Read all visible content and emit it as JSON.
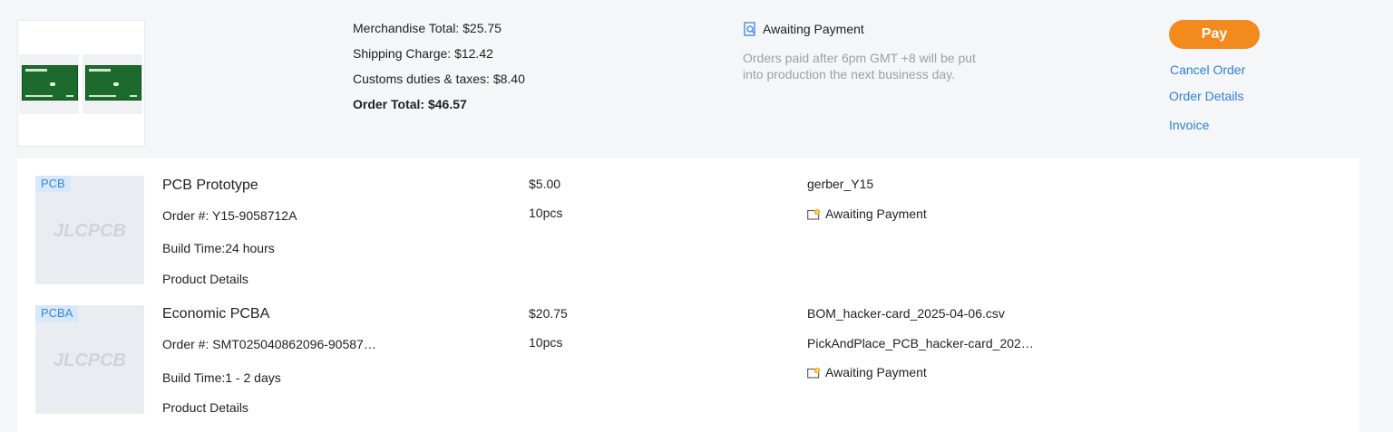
{
  "summary": {
    "merchandise_total": "Merchandise Total: $25.75",
    "shipping_charge": "Shipping Charge: $12.42",
    "customs": "Customs duties & taxes: $8.40",
    "order_total": "Order Total: $46.57",
    "status": "Awaiting Payment",
    "note": "Orders paid after 6pm GMT +8 will be put into production the next business day.",
    "pay_label": "Pay",
    "cancel_label": "Cancel Order",
    "details_label": "Order Details",
    "invoice_label": "Invoice",
    "colors": {
      "accent": "#f28a1e",
      "link": "#2f7fd9"
    }
  },
  "items": [
    {
      "tag": "PCB",
      "logo": "JLCPCB",
      "title": "PCB Prototype",
      "order": "Order #: Y15-9058712A",
      "build": "Build Time:24 hours",
      "details": "Product Details",
      "price": "$5.00",
      "qty": "10pcs",
      "files": [
        "gerber_Y15"
      ],
      "status": "Awaiting Payment"
    },
    {
      "tag": "PCBA",
      "logo": "JLCPCB",
      "title": "Economic PCBA",
      "order": "Order #: SMT025040862096-90587…",
      "build": "Build Time:1 - 2 days",
      "details": "Product Details",
      "price": "$20.75",
      "qty": "10pcs",
      "files": [
        "BOM_hacker-card_2025-04-06.csv",
        "PickAndPlace_PCB_hacker-card_202…"
      ],
      "status": "Awaiting Payment"
    }
  ]
}
